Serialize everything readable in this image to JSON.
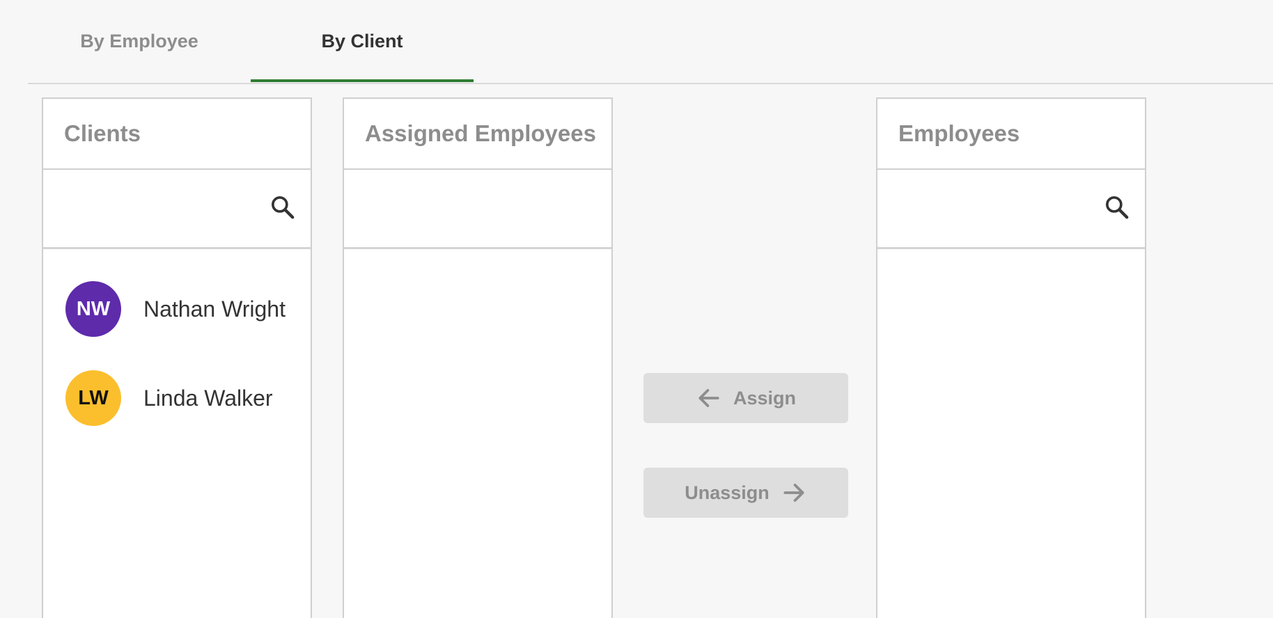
{
  "tabs": {
    "by_employee": "By Employee",
    "by_client": "By Client",
    "active": "By Client"
  },
  "clients_panel": {
    "title": "Clients",
    "search_value": "",
    "items": [
      {
        "initials": "NW",
        "name": "Nathan Wright",
        "avatar_color": "#5e2bab",
        "initials_color": "#ffffff"
      },
      {
        "initials": "LW",
        "name": "Linda Walker",
        "avatar_color": "#fbbf2d",
        "initials_color": "#111111"
      }
    ]
  },
  "assigned_panel": {
    "title": "Assigned Employees",
    "items": []
  },
  "actions": {
    "assign_label": "Assign",
    "unassign_label": "Unassign",
    "assign_icon": "arrow-left-icon",
    "unassign_icon": "arrow-right-icon",
    "disabled": true
  },
  "employees_panel": {
    "title": "Employees",
    "search_value": "",
    "items": []
  },
  "colors": {
    "accent": "#2e7d32",
    "disabled_bg": "#dedede",
    "muted_text": "#8d8d8d"
  }
}
